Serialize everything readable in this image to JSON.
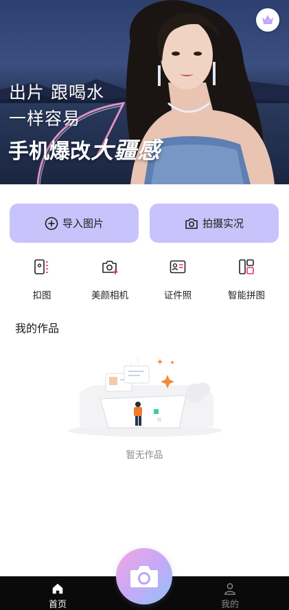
{
  "hero": {
    "line1": "出片 跟喝水",
    "line2": "一样容易",
    "line3_prefix": "手机爆改",
    "line3_emphasis": "大疆感"
  },
  "actions": {
    "import_label": "导入图片",
    "shoot_label": "拍摄实况"
  },
  "tools": [
    {
      "label": "扣图",
      "icon": "cutout-icon"
    },
    {
      "label": "美颜相机",
      "icon": "beauty-camera-icon"
    },
    {
      "label": "证件照",
      "icon": "id-photo-icon"
    },
    {
      "label": "智能拼图",
      "icon": "collage-icon"
    }
  ],
  "works": {
    "title": "我的作品",
    "empty_text": "暂无作品"
  },
  "nav": {
    "home_label": "首页",
    "mine_label": "我的"
  },
  "colors": {
    "action_bg": "#c9c3fb",
    "accent_pink": "#e8336a",
    "nav_bg": "#0a0a0a"
  }
}
